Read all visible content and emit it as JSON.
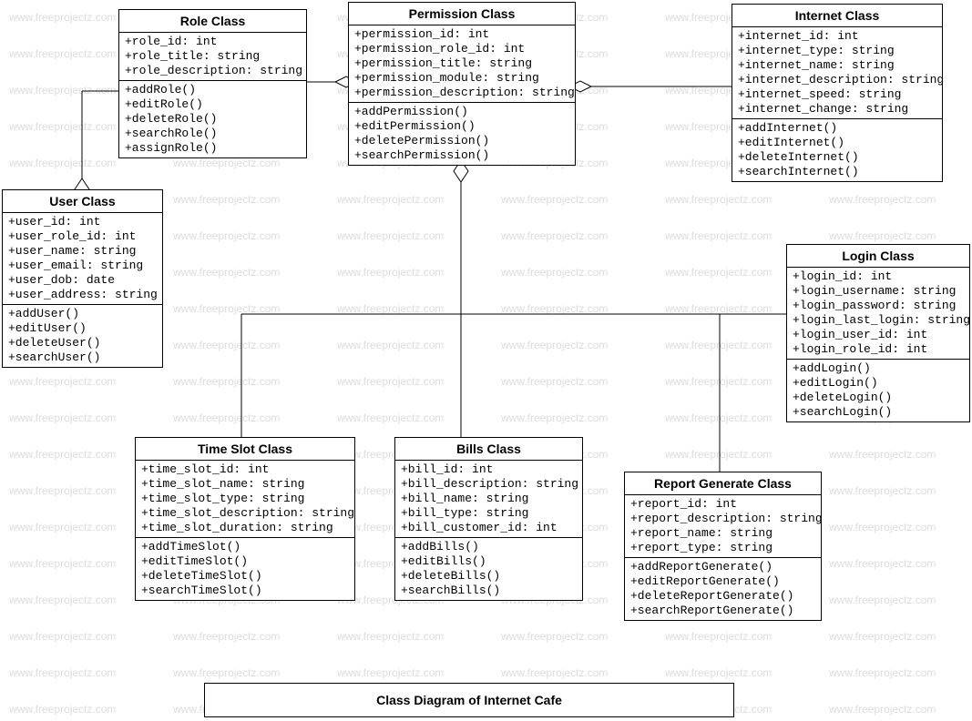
{
  "watermark_text": "www.freeprojectz.com",
  "diagram_title": "Class Diagram of Internet Cafe",
  "classes": {
    "role": {
      "title": "Role Class",
      "attrs": [
        "+role_id: int",
        "+role_title: string",
        "+role_description: string"
      ],
      "ops": [
        "+addRole()",
        "+editRole()",
        "+deleteRole()",
        "+searchRole()",
        "+assignRole()"
      ]
    },
    "permission": {
      "title": "Permission Class",
      "attrs": [
        "+permission_id: int",
        "+permission_role_id: int",
        "+permission_title: string",
        "+permission_module: string",
        "+permission_description: string"
      ],
      "ops": [
        "+addPermission()",
        "+editPermission()",
        "+deletePermission()",
        "+searchPermission()"
      ]
    },
    "internet": {
      "title": "Internet Class",
      "attrs": [
        "+internet_id: int",
        "+internet_type: string",
        "+internet_name: string",
        "+internet_description: string",
        "+internet_speed: string",
        "+internet_change: string"
      ],
      "ops": [
        "+addInternet()",
        "+editInternet()",
        "+deleteInternet()",
        "+searchInternet()"
      ]
    },
    "user": {
      "title": "User Class",
      "attrs": [
        "+user_id: int",
        "+user_role_id: int",
        "+user_name: string",
        "+user_email: string",
        "+user_dob: date",
        "+user_address: string"
      ],
      "ops": [
        "+addUser()",
        "+editUser()",
        "+deleteUser()",
        "+searchUser()"
      ]
    },
    "login": {
      "title": "Login Class",
      "attrs": [
        "+login_id: int",
        "+login_username: string",
        "+login_password: string",
        "+login_last_login: string",
        "+login_user_id: int",
        "+login_role_id: int"
      ],
      "ops": [
        "+addLogin()",
        "+editLogin()",
        "+deleteLogin()",
        "+searchLogin()"
      ]
    },
    "timeslot": {
      "title": "Time Slot Class",
      "attrs": [
        "+time_slot_id: int",
        "+time_slot_name: string",
        "+time_slot_type: string",
        "+time_slot_description: string",
        "+time_slot_duration: string"
      ],
      "ops": [
        "+addTimeSlot()",
        "+editTimeSlot()",
        "+deleteTimeSlot()",
        "+searchTimeSlot()"
      ]
    },
    "bills": {
      "title": "Bills Class",
      "attrs": [
        "+bill_id: int",
        "+bill_description: string",
        "+bill_name: string",
        "+bill_type: string",
        "+bill_customer_id: int"
      ],
      "ops": [
        "+addBills()",
        "+editBills()",
        "+deleteBills()",
        "+searchBills()"
      ]
    },
    "report": {
      "title": "Report Generate Class",
      "attrs": [
        "+report_id: int",
        "+report_description: string",
        "+report_name: string",
        "+report_type: string"
      ],
      "ops": [
        "+addReportGenerate()",
        "+editReportGenerate()",
        "+deleteReportGenerate()",
        "+searchReportGenerate()"
      ]
    }
  }
}
